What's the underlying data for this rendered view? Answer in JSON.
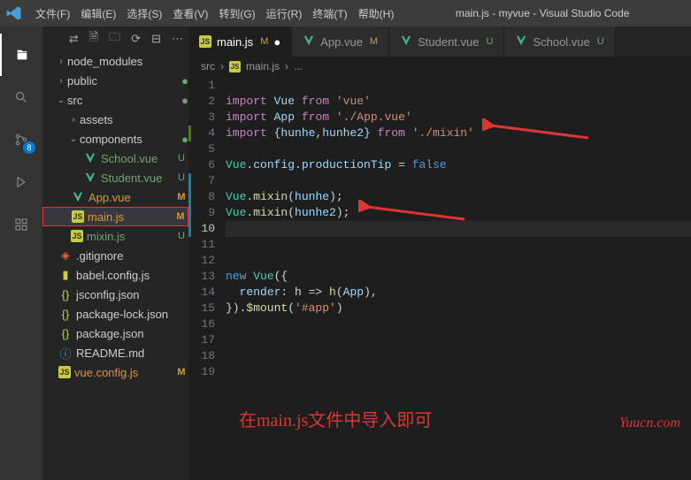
{
  "title": "main.js - myvue - Visual Studio Code",
  "menu": [
    "文件(F)",
    "编辑(E)",
    "选择(S)",
    "查看(V)",
    "转到(G)",
    "运行(R)",
    "终端(T)",
    "帮助(H)"
  ],
  "activitybar": {
    "badge": "8"
  },
  "tree": {
    "node_modules": "node_modules",
    "public": "public",
    "src": "src",
    "assets": "assets",
    "components": "components",
    "school": "School.vue",
    "student": "Student.vue",
    "app": "App.vue",
    "main": "main.js",
    "mixin": "mixin.js",
    "gitignore": ".gitignore",
    "babel": "babel.config.js",
    "jsconfig": "jsconfig.json",
    "pkglock": "package-lock.json",
    "pkg": "package.json",
    "readme": "README.md",
    "vueconfig": "vue.config.js",
    "status_U": "U",
    "status_M": "M"
  },
  "tabs": [
    {
      "icon": "js",
      "label": "main.js",
      "status": "M",
      "active": true,
      "modified": true
    },
    {
      "icon": "vue",
      "label": "App.vue",
      "status": "M",
      "active": false
    },
    {
      "icon": "vue",
      "label": "Student.vue",
      "status": "U",
      "active": false
    },
    {
      "icon": "vue",
      "label": "School.vue",
      "status": "U",
      "active": false
    }
  ],
  "breadcrumb": {
    "src": "src",
    "file": "main.js",
    "more": "..."
  },
  "code": {
    "l2": {
      "import": "import",
      "v": "Vue",
      "from": "from",
      "s": "'vue'"
    },
    "l3": {
      "import": "import",
      "v": "App",
      "from": "from",
      "s": "'./App.vue'"
    },
    "l4": {
      "import": "import",
      "b": "{hunhe,hunhe2}",
      "from": "from",
      "s": "'./mixin'"
    },
    "l6": {
      "a": "Vue",
      "b": "config",
      "c": "productionTip",
      "eq": " = ",
      "d": "false"
    },
    "l8": {
      "a": "Vue",
      "fn": "mixin",
      "arg": "hunhe"
    },
    "l9": {
      "a": "Vue",
      "fn": "mixin",
      "arg": "hunhe2"
    },
    "l13": {
      "new": "new",
      "cls": "Vue",
      "open": "({"
    },
    "l14": {
      "key": "render",
      "arrow": ": h => ",
      "fn": "h",
      "arg": "App",
      "close": "),"
    },
    "l15": {
      "close": "}).",
      "fn": "$mount",
      "open": "(",
      "s": "'#app'",
      ").": ")"
    }
  },
  "annotation": "在main.js文件中导入即可",
  "watermark": "Yuucn.com"
}
